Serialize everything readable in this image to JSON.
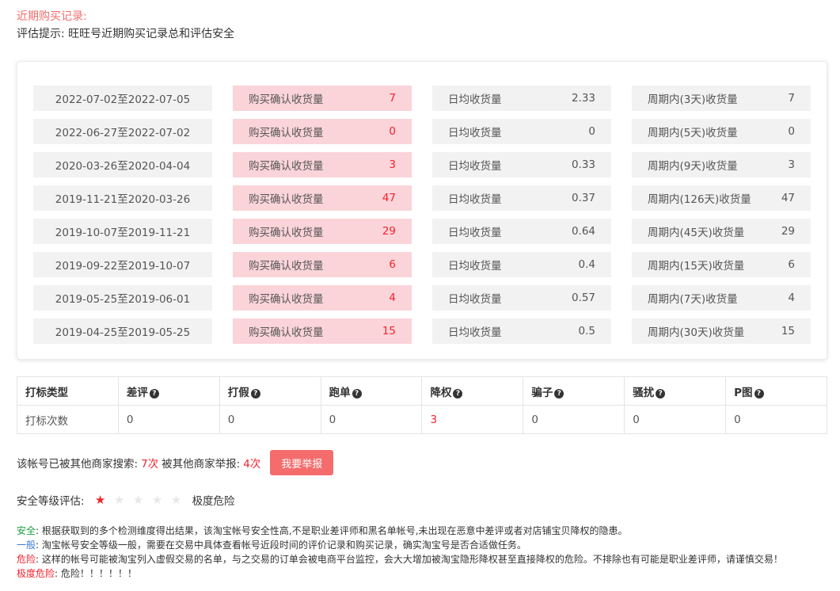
{
  "header": {
    "title": "近期购买记录:",
    "hint": "评估提示: 旺旺号近期购买记录总和评估安全"
  },
  "records": [
    {
      "range": "2022-07-02至2022-07-05",
      "confirm_label": "购买确认收货量",
      "confirm_value": "7",
      "daily_label": "日均收货量",
      "daily_value": "2.33",
      "period_label": "周期内(3天)收货量",
      "period_value": "7"
    },
    {
      "range": "2022-06-27至2022-07-02",
      "confirm_label": "购买确认收货量",
      "confirm_value": "0",
      "daily_label": "日均收货量",
      "daily_value": "0",
      "period_label": "周期内(5天)收货量",
      "period_value": "0"
    },
    {
      "range": "2020-03-26至2020-04-04",
      "confirm_label": "购买确认收货量",
      "confirm_value": "3",
      "daily_label": "日均收货量",
      "daily_value": "0.33",
      "period_label": "周期内(9天)收货量",
      "period_value": "3"
    },
    {
      "range": "2019-11-21至2020-03-26",
      "confirm_label": "购买确认收货量",
      "confirm_value": "47",
      "daily_label": "日均收货量",
      "daily_value": "0.37",
      "period_label": "周期内(126天)收货量",
      "period_value": "47"
    },
    {
      "range": "2019-10-07至2019-11-21",
      "confirm_label": "购买确认收货量",
      "confirm_value": "29",
      "daily_label": "日均收货量",
      "daily_value": "0.64",
      "period_label": "周期内(45天)收货量",
      "period_value": "29"
    },
    {
      "range": "2019-09-22至2019-10-07",
      "confirm_label": "购买确认收货量",
      "confirm_value": "6",
      "daily_label": "日均收货量",
      "daily_value": "0.4",
      "period_label": "周期内(15天)收货量",
      "period_value": "6"
    },
    {
      "range": "2019-05-25至2019-06-01",
      "confirm_label": "购买确认收货量",
      "confirm_value": "4",
      "daily_label": "日均收货量",
      "daily_value": "0.57",
      "period_label": "周期内(7天)收货量",
      "period_value": "4"
    },
    {
      "range": "2019-04-25至2019-05-25",
      "confirm_label": "购买确认收货量",
      "confirm_value": "15",
      "daily_label": "日均收货量",
      "daily_value": "0.5",
      "period_label": "周期内(30天)收货量",
      "period_value": "15"
    }
  ],
  "marks": {
    "header_label": "打标类型",
    "row_label": "打标次数",
    "help_icon": "question-circle-icon",
    "columns": [
      {
        "label": "差评",
        "value": "0",
        "highlight": false
      },
      {
        "label": "打假",
        "value": "0",
        "highlight": false
      },
      {
        "label": "跑单",
        "value": "0",
        "highlight": false
      },
      {
        "label": "降权",
        "value": "3",
        "highlight": true
      },
      {
        "label": "骗子",
        "value": "0",
        "highlight": false
      },
      {
        "label": "骚扰",
        "value": "0",
        "highlight": false
      },
      {
        "label": "P图",
        "value": "0",
        "highlight": false
      }
    ]
  },
  "search": {
    "searched_label": "该帐号已被其他商家搜索:",
    "searched_value": "7次",
    "reported_label": "被其他商家举报:",
    "reported_value": "4次",
    "report_button": "我要举报"
  },
  "safety": {
    "label": "安全等级评估:",
    "stars_total": 5,
    "stars_filled": 1,
    "level_text": "极度危险"
  },
  "legend": [
    {
      "label": "安全",
      "text": ": 根据获取到的多个检测维度得出结果，该淘宝帐号安全性高,不是职业差评师和黑名单帐号,未出现在恶意中差评或者对店铺宝贝降权的隐患。",
      "color": "#1a9e3c"
    },
    {
      "label": "一般",
      "text": ": 淘宝帐号安全等级一般，需要在交易中具体查看帐号近段时间的评价记录和购买记录，确实淘宝号是否合适做任务。",
      "color": "#3a7bd5"
    },
    {
      "label": "危险",
      "text": ": 这样的帐号可能被淘宝列入虚假交易的名单，与之交易的订单会被电商平台监控，会大大增加被淘宝隐形降权甚至直接降权的危险。不排除也有可能是职业差评师，请谨慎交易！",
      "color": "#f5222d"
    },
    {
      "label": "极度危险",
      "text": ": 危险！！！！！！",
      "color": "#f5222d"
    }
  ]
}
